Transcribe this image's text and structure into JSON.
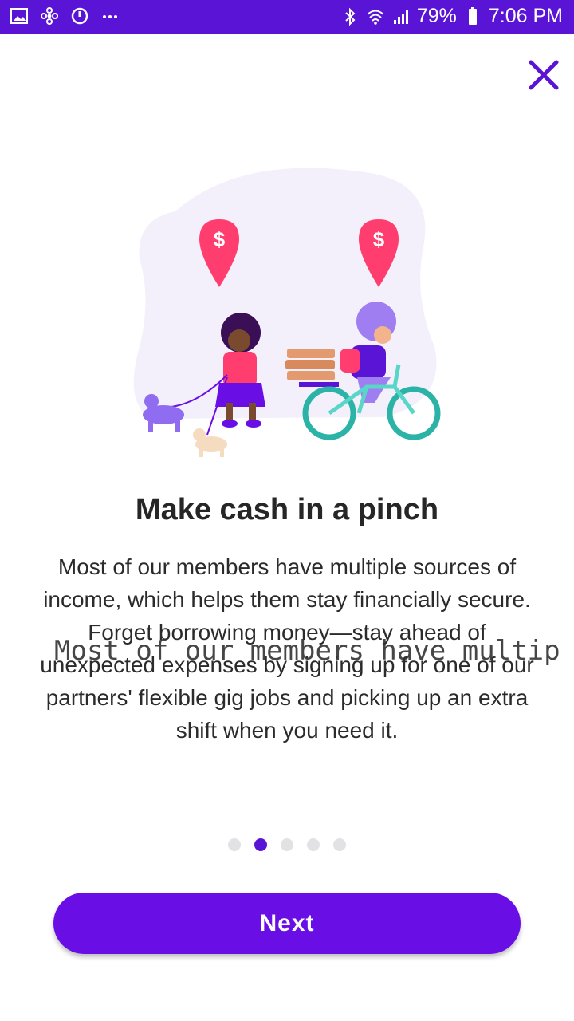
{
  "status_bar": {
    "battery": "79%",
    "time": "7:06 PM",
    "left_icons": [
      "gallery-icon",
      "fan-icon",
      "sync-icon",
      "more-dots-icon"
    ],
    "right_icons": [
      "bluetooth-icon",
      "wifi-icon",
      "signal-icon",
      "battery-icon"
    ]
  },
  "header": {
    "close_icon": "close-icon"
  },
  "slide": {
    "title": "Make cash in a pinch",
    "body": "Most of our members have multiple sources of income, which helps them stay financially secure. Forget borrowing money—stay ahead of unexpected expenses by signing up for one of our partners' flexible gig jobs and picking up an extra shift when you need it.",
    "overlay_text": "Most of our members have multip",
    "illustration": "gig-workers-illustration"
  },
  "pager": {
    "count": 5,
    "active_index": 1
  },
  "actions": {
    "next_label": "Next"
  },
  "colors": {
    "primary": "#5a14d6",
    "button": "#6a0ee6",
    "pin": "#ff3d6e",
    "bike": "#2ab3a6"
  }
}
